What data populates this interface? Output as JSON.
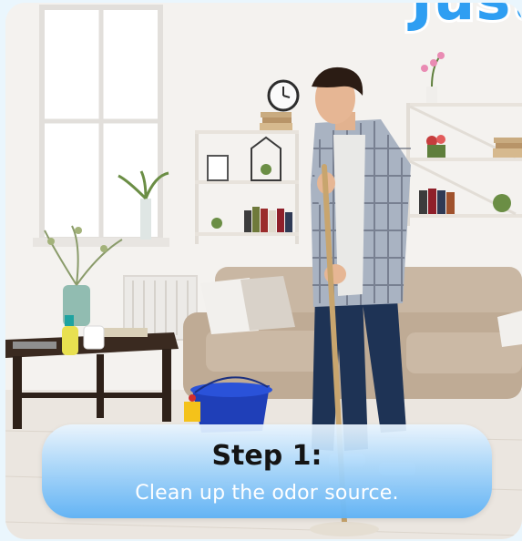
{
  "headline": {
    "text": "Just"
  },
  "caption": {
    "title": "Step 1:",
    "text": "Clean up the odor source."
  },
  "photo": {
    "icon": "man-mopping-living-room-photo"
  },
  "colors": {
    "headline": "#2e9ef2",
    "caption_gradient_top": "#eaf5ff",
    "caption_gradient_bottom": "#5fb2f5",
    "caption_title": "#141414",
    "caption_text": "#ffffff"
  }
}
